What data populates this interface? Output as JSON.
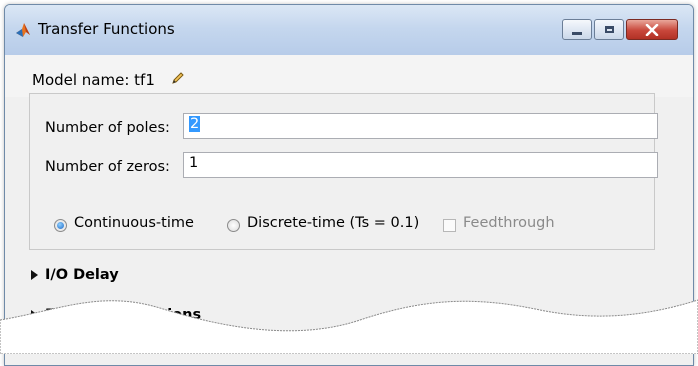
{
  "window": {
    "title": "Transfer Functions"
  },
  "model": {
    "label": "Model name: tf1"
  },
  "form": {
    "poles_label": "Number of poles:",
    "poles_value": "2",
    "zeros_label": "Number of zeros:",
    "zeros_value": "1"
  },
  "time_options": {
    "continuous": "Continuous-time",
    "discrete": "Discrete-time (Ts = 0.1)",
    "feedthrough": "Feedthrough",
    "selected": "Continuous-time"
  },
  "sections": [
    {
      "label": "I/O Delay"
    },
    {
      "label": "Estimation Options"
    }
  ],
  "colors": {
    "titlebar": "#c5d7ee",
    "selection": "#3399ff",
    "close_button": "#c8473b"
  },
  "icons": [
    "matlab-logo-icon",
    "pencil-icon",
    "minimize-icon",
    "maximize-icon",
    "close-icon",
    "expand-triangle-icon"
  ]
}
